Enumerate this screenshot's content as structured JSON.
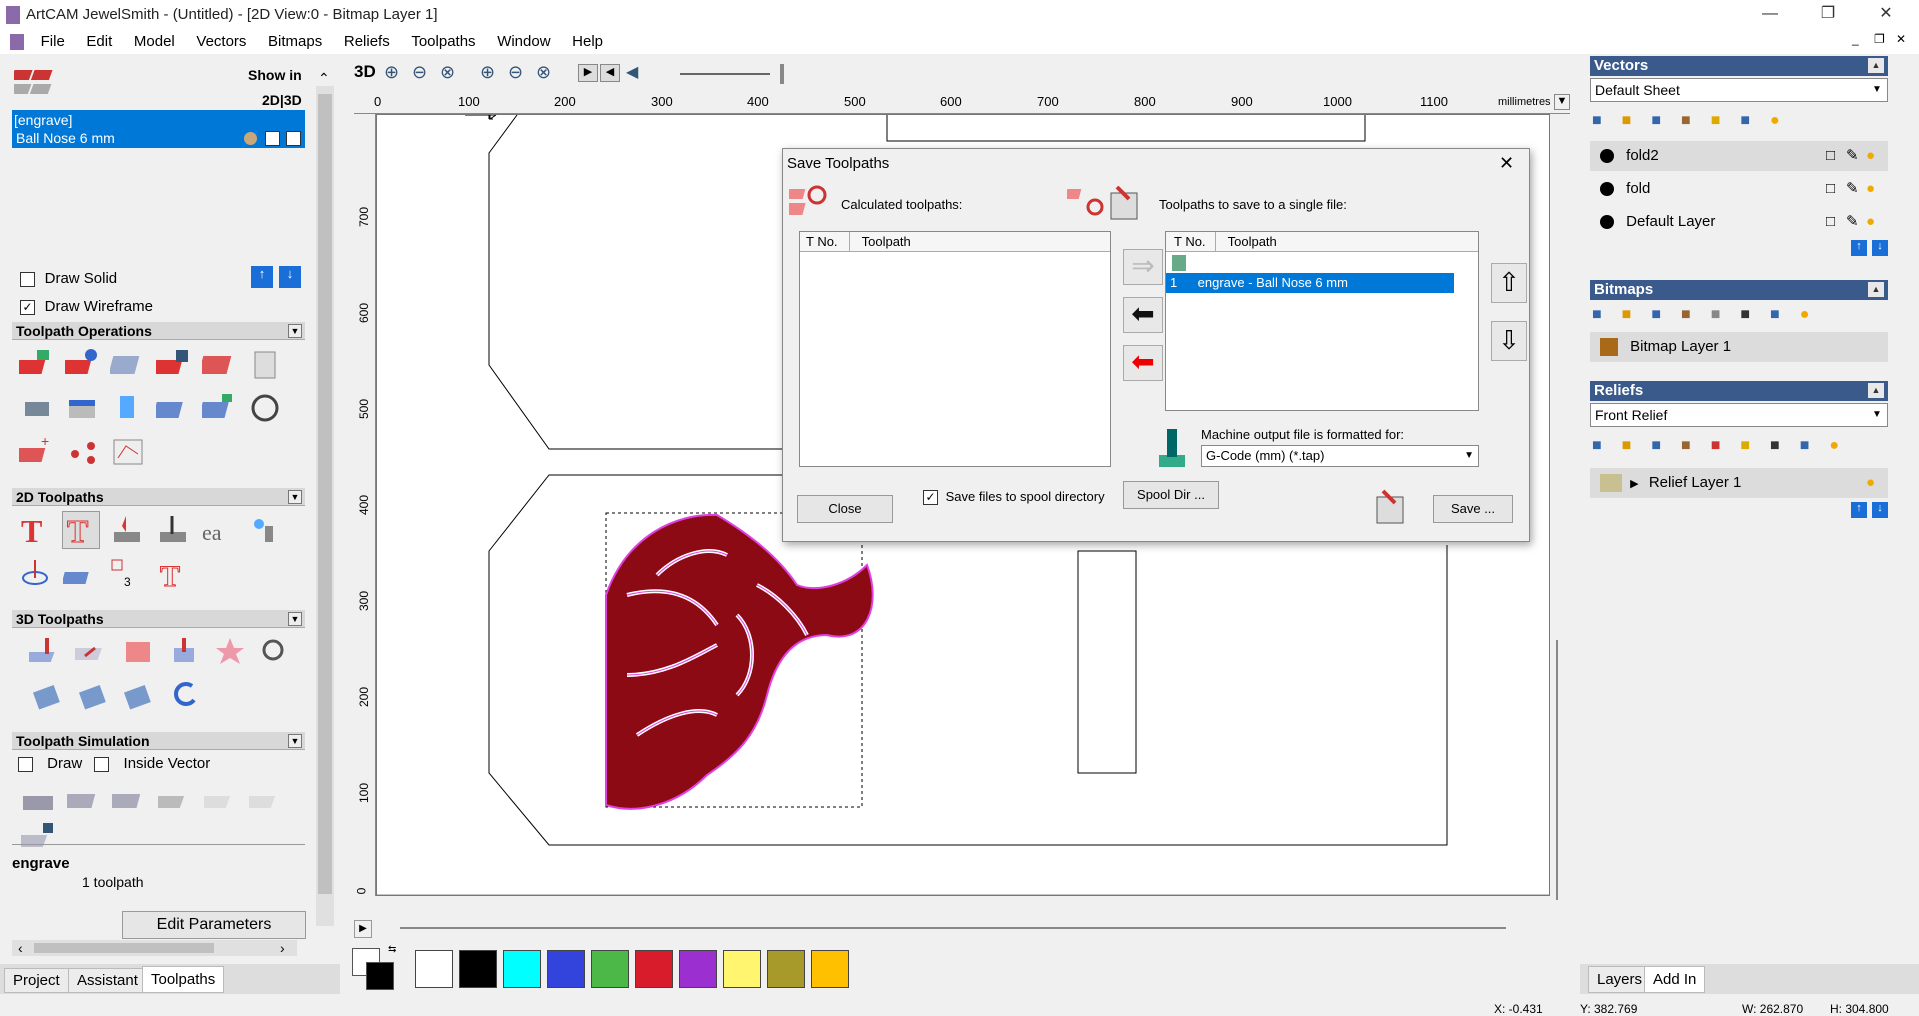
{
  "window": {
    "title": "ArtCAM JewelSmith - (Untitled) - [2D View:0 - Bitmap Layer 1]"
  },
  "menu": [
    "File",
    "Edit",
    "Model",
    "Vectors",
    "Bitmaps",
    "Reliefs",
    "Toolpaths",
    "Window",
    "Help"
  ],
  "left": {
    "show_in": "Show in",
    "show_in_mode": "2D|3D",
    "selected_group": "[engrave]",
    "selected_tool": "Ball Nose 6 mm",
    "draw_solid": "Draw Solid",
    "draw_wireframe": "Draw Wireframe",
    "sections": [
      "Toolpath Operations",
      "2D Toolpaths",
      "3D Toolpaths",
      "Toolpath Simulation"
    ],
    "sim_draw": "Draw",
    "sim_inside": "Inside Vector",
    "summary_name": "engrave",
    "summary_count": "1 toolpath",
    "edit_params": "Edit Parameters",
    "tabs": [
      "Project",
      "Assistant",
      "Toolpaths"
    ]
  },
  "view": {
    "label_3d": "3D",
    "units": "millimetres",
    "ruler_x": [
      "0",
      "100",
      "200",
      "300",
      "400",
      "500",
      "600",
      "700",
      "800",
      "900",
      "1000",
      "1100"
    ],
    "ruler_y": [
      "700",
      "600",
      "500",
      "400",
      "300",
      "200",
      "100",
      "0"
    ]
  },
  "dialog": {
    "title": "Save Toolpaths",
    "calculated_label": "Calculated toolpaths:",
    "save_single_label": "Toolpaths to save to a single file:",
    "col_tno": "T No.",
    "col_toolpath": "Toolpath",
    "save_list": [
      {
        "tno": "1",
        "name": "engrave - Ball Nose 6 mm"
      }
    ],
    "machine_label": "Machine output file is formatted for:",
    "format_value": "G-Code (mm) (*.tap)",
    "spool_check": "Save files to spool directory",
    "spool_dir": "Spool Dir ...",
    "close": "Close",
    "save": "Save ..."
  },
  "right": {
    "vectors": "Vectors",
    "sheet": "Default Sheet",
    "vector_layers": [
      "fold2",
      "fold",
      "Default Layer"
    ],
    "bitmaps": "Bitmaps",
    "bitmap_layer": "Bitmap Layer 1",
    "reliefs": "Reliefs",
    "relief_combo": "Front Relief",
    "relief_layer": "Relief Layer 1",
    "tabs": [
      "Layers",
      "Add In"
    ]
  },
  "palette": [
    "#ffffff",
    "#000000",
    "#00ffff",
    "#3344dd",
    "#4cb848",
    "#d81c2c",
    "#9b2fd0",
    "#fff56e",
    "#a89a2a",
    "#ffc000"
  ],
  "status": {
    "x": "X: -0.431",
    "y": "Y: 382.769",
    "w": "W: 262.870",
    "h": "H: 304.800"
  },
  "colors": {
    "accent": "#0078d7",
    "panel_header": "#3b5a8c",
    "engrave": "#8b0a14"
  }
}
